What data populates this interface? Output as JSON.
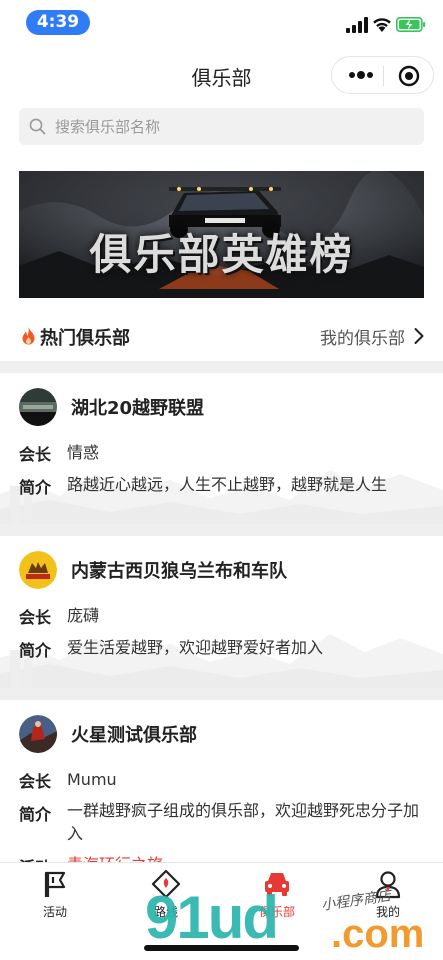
{
  "status_bar": {
    "time": "4:39"
  },
  "nav": {
    "title": "俱乐部"
  },
  "search": {
    "placeholder": "搜索俱乐部名称"
  },
  "banner": {
    "text": "俱乐部英雄榜",
    "truck_plate": "TOYO TIRES"
  },
  "hot_section": {
    "title": "热门俱乐部",
    "my_clubs_link": "我的俱乐部"
  },
  "clubs": [
    {
      "name": "湖北20越野联盟",
      "leader_label": "会长",
      "leader": "情惑",
      "intro_label": "简介",
      "intro": "路越近心越远，人生不止越野，越野就是人生"
    },
    {
      "name": "内蒙古西贝狼乌兰布和车队",
      "leader_label": "会长",
      "leader": "庞礴",
      "intro_label": "简介",
      "intro": "爱生活爱越野，欢迎越野爱好者加入"
    },
    {
      "name": "火星测试俱乐部",
      "leader_label": "会长",
      "leader": "Mumu",
      "intro_label": "简介",
      "intro": "一群越野疯子组成的俱乐部，欢迎越野死忠分子加入",
      "activity_label": "活动",
      "activity": "青海环行之旅"
    }
  ],
  "tabbar": {
    "items": [
      {
        "label": "活动",
        "icon": "flag-icon",
        "active": false
      },
      {
        "label": "路线",
        "icon": "route-icon",
        "active": false
      },
      {
        "label": "俱乐部",
        "icon": "car-icon",
        "active": true
      },
      {
        "label": "我的",
        "icon": "user-icon",
        "active": false
      }
    ]
  },
  "watermark": {
    "text": "91ud",
    "suffix": ".com",
    "caption": "小程序商店"
  },
  "colors": {
    "accent": "#e53935",
    "status_pill": "#2f7cf6",
    "battery": "#35c759"
  }
}
